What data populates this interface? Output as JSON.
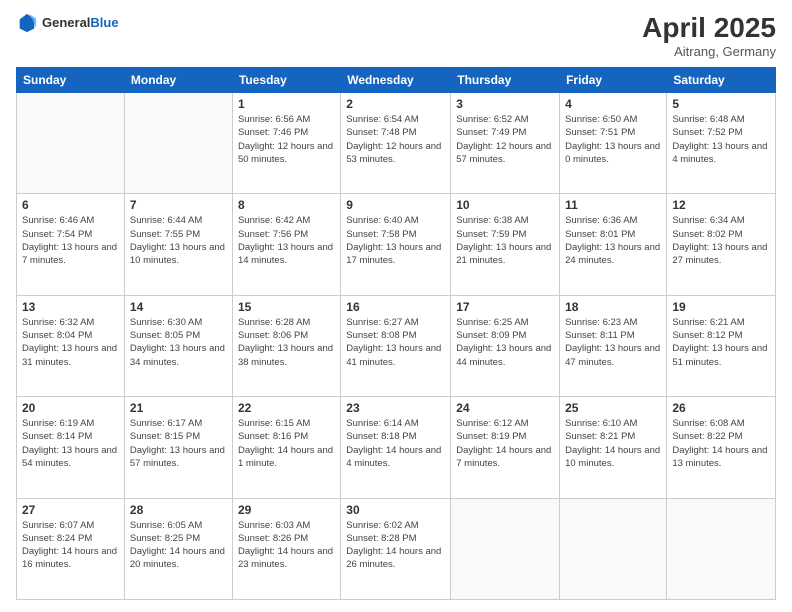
{
  "header": {
    "logo_general": "General",
    "logo_blue": "Blue",
    "month": "April 2025",
    "location": "Aitrang, Germany"
  },
  "weekdays": [
    "Sunday",
    "Monday",
    "Tuesday",
    "Wednesday",
    "Thursday",
    "Friday",
    "Saturday"
  ],
  "weeks": [
    [
      {
        "day": "",
        "sunrise": "",
        "sunset": "",
        "daylight": ""
      },
      {
        "day": "",
        "sunrise": "",
        "sunset": "",
        "daylight": ""
      },
      {
        "day": "1",
        "sunrise": "Sunrise: 6:56 AM",
        "sunset": "Sunset: 7:46 PM",
        "daylight": "Daylight: 12 hours and 50 minutes."
      },
      {
        "day": "2",
        "sunrise": "Sunrise: 6:54 AM",
        "sunset": "Sunset: 7:48 PM",
        "daylight": "Daylight: 12 hours and 53 minutes."
      },
      {
        "day": "3",
        "sunrise": "Sunrise: 6:52 AM",
        "sunset": "Sunset: 7:49 PM",
        "daylight": "Daylight: 12 hours and 57 minutes."
      },
      {
        "day": "4",
        "sunrise": "Sunrise: 6:50 AM",
        "sunset": "Sunset: 7:51 PM",
        "daylight": "Daylight: 13 hours and 0 minutes."
      },
      {
        "day": "5",
        "sunrise": "Sunrise: 6:48 AM",
        "sunset": "Sunset: 7:52 PM",
        "daylight": "Daylight: 13 hours and 4 minutes."
      }
    ],
    [
      {
        "day": "6",
        "sunrise": "Sunrise: 6:46 AM",
        "sunset": "Sunset: 7:54 PM",
        "daylight": "Daylight: 13 hours and 7 minutes."
      },
      {
        "day": "7",
        "sunrise": "Sunrise: 6:44 AM",
        "sunset": "Sunset: 7:55 PM",
        "daylight": "Daylight: 13 hours and 10 minutes."
      },
      {
        "day": "8",
        "sunrise": "Sunrise: 6:42 AM",
        "sunset": "Sunset: 7:56 PM",
        "daylight": "Daylight: 13 hours and 14 minutes."
      },
      {
        "day": "9",
        "sunrise": "Sunrise: 6:40 AM",
        "sunset": "Sunset: 7:58 PM",
        "daylight": "Daylight: 13 hours and 17 minutes."
      },
      {
        "day": "10",
        "sunrise": "Sunrise: 6:38 AM",
        "sunset": "Sunset: 7:59 PM",
        "daylight": "Daylight: 13 hours and 21 minutes."
      },
      {
        "day": "11",
        "sunrise": "Sunrise: 6:36 AM",
        "sunset": "Sunset: 8:01 PM",
        "daylight": "Daylight: 13 hours and 24 minutes."
      },
      {
        "day": "12",
        "sunrise": "Sunrise: 6:34 AM",
        "sunset": "Sunset: 8:02 PM",
        "daylight": "Daylight: 13 hours and 27 minutes."
      }
    ],
    [
      {
        "day": "13",
        "sunrise": "Sunrise: 6:32 AM",
        "sunset": "Sunset: 8:04 PM",
        "daylight": "Daylight: 13 hours and 31 minutes."
      },
      {
        "day": "14",
        "sunrise": "Sunrise: 6:30 AM",
        "sunset": "Sunset: 8:05 PM",
        "daylight": "Daylight: 13 hours and 34 minutes."
      },
      {
        "day": "15",
        "sunrise": "Sunrise: 6:28 AM",
        "sunset": "Sunset: 8:06 PM",
        "daylight": "Daylight: 13 hours and 38 minutes."
      },
      {
        "day": "16",
        "sunrise": "Sunrise: 6:27 AM",
        "sunset": "Sunset: 8:08 PM",
        "daylight": "Daylight: 13 hours and 41 minutes."
      },
      {
        "day": "17",
        "sunrise": "Sunrise: 6:25 AM",
        "sunset": "Sunset: 8:09 PM",
        "daylight": "Daylight: 13 hours and 44 minutes."
      },
      {
        "day": "18",
        "sunrise": "Sunrise: 6:23 AM",
        "sunset": "Sunset: 8:11 PM",
        "daylight": "Daylight: 13 hours and 47 minutes."
      },
      {
        "day": "19",
        "sunrise": "Sunrise: 6:21 AM",
        "sunset": "Sunset: 8:12 PM",
        "daylight": "Daylight: 13 hours and 51 minutes."
      }
    ],
    [
      {
        "day": "20",
        "sunrise": "Sunrise: 6:19 AM",
        "sunset": "Sunset: 8:14 PM",
        "daylight": "Daylight: 13 hours and 54 minutes."
      },
      {
        "day": "21",
        "sunrise": "Sunrise: 6:17 AM",
        "sunset": "Sunset: 8:15 PM",
        "daylight": "Daylight: 13 hours and 57 minutes."
      },
      {
        "day": "22",
        "sunrise": "Sunrise: 6:15 AM",
        "sunset": "Sunset: 8:16 PM",
        "daylight": "Daylight: 14 hours and 1 minute."
      },
      {
        "day": "23",
        "sunrise": "Sunrise: 6:14 AM",
        "sunset": "Sunset: 8:18 PM",
        "daylight": "Daylight: 14 hours and 4 minutes."
      },
      {
        "day": "24",
        "sunrise": "Sunrise: 6:12 AM",
        "sunset": "Sunset: 8:19 PM",
        "daylight": "Daylight: 14 hours and 7 minutes."
      },
      {
        "day": "25",
        "sunrise": "Sunrise: 6:10 AM",
        "sunset": "Sunset: 8:21 PM",
        "daylight": "Daylight: 14 hours and 10 minutes."
      },
      {
        "day": "26",
        "sunrise": "Sunrise: 6:08 AM",
        "sunset": "Sunset: 8:22 PM",
        "daylight": "Daylight: 14 hours and 13 minutes."
      }
    ],
    [
      {
        "day": "27",
        "sunrise": "Sunrise: 6:07 AM",
        "sunset": "Sunset: 8:24 PM",
        "daylight": "Daylight: 14 hours and 16 minutes."
      },
      {
        "day": "28",
        "sunrise": "Sunrise: 6:05 AM",
        "sunset": "Sunset: 8:25 PM",
        "daylight": "Daylight: 14 hours and 20 minutes."
      },
      {
        "day": "29",
        "sunrise": "Sunrise: 6:03 AM",
        "sunset": "Sunset: 8:26 PM",
        "daylight": "Daylight: 14 hours and 23 minutes."
      },
      {
        "day": "30",
        "sunrise": "Sunrise: 6:02 AM",
        "sunset": "Sunset: 8:28 PM",
        "daylight": "Daylight: 14 hours and 26 minutes."
      },
      {
        "day": "",
        "sunrise": "",
        "sunset": "",
        "daylight": ""
      },
      {
        "day": "",
        "sunrise": "",
        "sunset": "",
        "daylight": ""
      },
      {
        "day": "",
        "sunrise": "",
        "sunset": "",
        "daylight": ""
      }
    ]
  ]
}
